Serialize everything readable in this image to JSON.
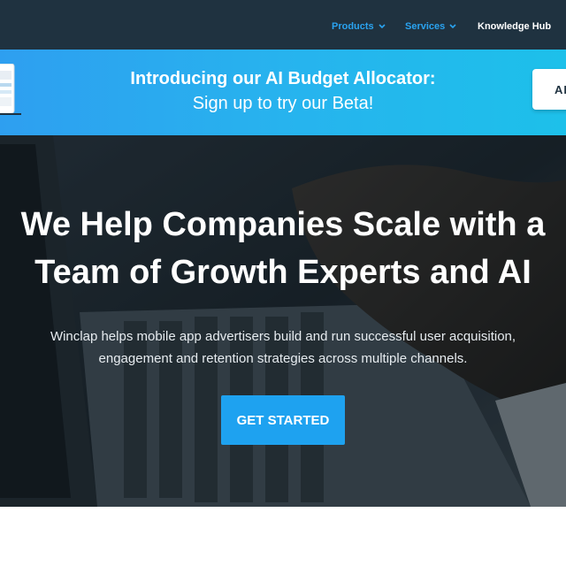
{
  "nav": {
    "items": [
      {
        "label": "Products",
        "has_dropdown": true
      },
      {
        "label": "Services",
        "has_dropdown": true
      },
      {
        "label": "Knowledge Hub",
        "has_dropdown": false
      }
    ],
    "colors": {
      "background": "#1f3240",
      "link": "#2aa3f0",
      "link_active": "#ffffff"
    }
  },
  "banner": {
    "title": "Introducing our AI Budget Allocator:",
    "subtitle": "Sign up to try our Beta!",
    "button_label": "AP",
    "colors": {
      "gradient_start": "#2e9ff0",
      "gradient_end": "#1dc0ea"
    }
  },
  "hero": {
    "headline_line1": "We Help Companies Scale with a",
    "headline_line2": "Team of Growth Experts and AI",
    "description_line1": "Winclap helps mobile app advertisers build and run successful user acquisition,",
    "description_line2": "engagement and retention strategies across multiple channels.",
    "cta_label": "GET STARTED",
    "colors": {
      "cta": "#1ea2f0"
    }
  }
}
